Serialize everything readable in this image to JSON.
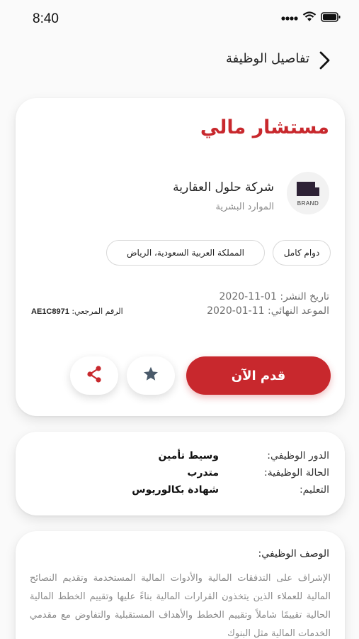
{
  "status_bar": {
    "time": "8:40"
  },
  "header": {
    "title": "تفاصيل الوظيفة"
  },
  "job": {
    "title": "مستشار مالي",
    "company": "شركة حلول العقارية",
    "department": "الموارد البشرية",
    "logo_text": "BRAND",
    "tags": {
      "type": "دوام كامل",
      "location": "المملكة العربية السعودية، الرياض"
    },
    "posted": "تاريخ النشر: 01-11-2020",
    "deadline": "الموعد النهائي: 11-01-2020",
    "reference_label": "الرقم المرجعي:",
    "reference_value": "AE1C8971",
    "apply_label": "قدم الآن"
  },
  "details": {
    "rows": [
      {
        "label": "الدور الوظيفي:",
        "value": "وسيط تأمين"
      },
      {
        "label": "الحالة الوظيفية:",
        "value": "متدرب"
      },
      {
        "label": "التعليم:",
        "value": "شهادة بكالوريوس"
      }
    ]
  },
  "description": {
    "title": "الوصف الوظيفي:",
    "text": "الإشراف على التدفقات المالية والأدوات المالية المستخدمة وتقديم النصائح المالية للعملاء الذين يتخذون القرارات المالية بناءً عليها وتقييم الخطط المالية الحالية تقييمًا شاملاً وتقييم الخطط والأهداف المستقبلية والتفاوض مع مقدمي الخدمات المالية مثل البنوك"
  },
  "colors": {
    "accent": "#c8282d",
    "icon": "#4a5a6a"
  },
  "icons": {
    "back": "chevron-right-icon",
    "favorite": "star-icon",
    "share": "share-icon"
  }
}
